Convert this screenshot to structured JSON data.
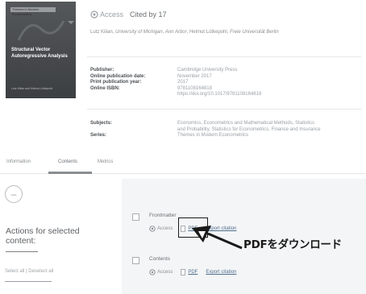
{
  "book": {
    "cover_series": "Themes in Modern Econometrics",
    "cover_title": "Structural Vector Autoregressive Analysis",
    "cover_authors": "Lutz Kilian and Helmut Lütkepohl"
  },
  "header": {
    "access_label": "Access",
    "cited_by": "Cited by 17"
  },
  "authors": {
    "author1_name": "Lutz Kilian",
    "author1_affil": "University of Michigan, Ann Arbor",
    "author2_name": "Helmut Lütkepohl",
    "author2_affil": "Freie Universität Berlin"
  },
  "metadata": {
    "publisher_label": "Publisher:",
    "online_date_label": "Online publication date:",
    "print_year_label": "Print publication year:",
    "online_isbn_label": "Online ISBN:",
    "publisher": "Cambridge University Press",
    "online_date": "November 2017",
    "print_year": "2017",
    "online_isbn": "9781108164818",
    "doi": "https://doi.org/10.1017/9781108164818",
    "subjects_label": "Subjects:",
    "series_label": "Series:",
    "subjects_line1": "Economics, Econometrics and Mathematical Methods, Statistics",
    "subjects_line2": "and Probability, Statistics for Econometrics, Finance and Insurance",
    "series": "Themes in Modern Econometrics"
  },
  "tabs": {
    "information": "Information",
    "contents": "Contents",
    "metrics": "Metrics"
  },
  "left_panel": {
    "collapse_symbol": "–",
    "actions_title": "Actions for selected content:",
    "select_all": "Select all",
    "separator": "|",
    "deselect_all": "Deselect all"
  },
  "chapters": [
    {
      "title": "Frontmatter",
      "access": "Access",
      "pdf": "PDF",
      "export": "Export citation"
    },
    {
      "title": "Contents",
      "access": "Access",
      "pdf": "PDF",
      "export": "Export citation"
    }
  ],
  "callout": {
    "text": "PDFをダウンロード"
  }
}
